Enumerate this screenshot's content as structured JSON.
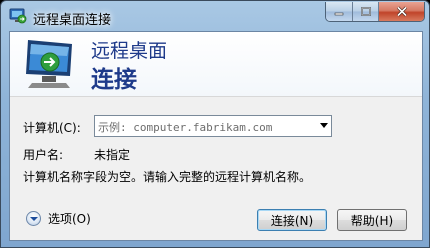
{
  "window": {
    "title": "远程桌面连接",
    "header_line1": "远程桌面",
    "header_line2": "连接"
  },
  "icons": {
    "title_icon": "remote-desktop-icon",
    "header_icon": "monitor-connection-icon",
    "options_icon": "chevron-down-circle-icon",
    "close_color": "#c0442a",
    "header_text_color": "#1e3a8a"
  },
  "form": {
    "computer_label": "计算机(C):",
    "computer_placeholder": "示例: computer.fabrikam.com",
    "username_label": "用户名:",
    "username_value": "未指定",
    "message": "计算机名称字段为空。请输入完整的远程计算机名称。"
  },
  "footer": {
    "options_label": "选项(O)",
    "connect_button": "连接(N)",
    "help_button": "帮助(H)"
  }
}
